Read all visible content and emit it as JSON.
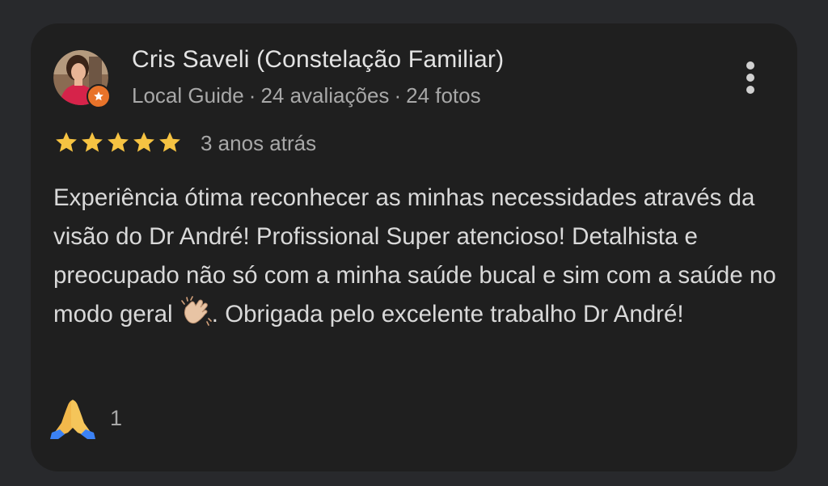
{
  "review": {
    "reviewer_name": "Cris Saveli (Constelação Familiar)",
    "reviewer_level": "Local Guide",
    "review_count": "24 avaliações",
    "photo_count": "24 fotos",
    "separator": "·",
    "rating": 5,
    "max_rating": 5,
    "time_ago": "3 anos atrás",
    "text_before_emoji": "Experiência ótima reconhecer as minhas necessidades através da visão do Dr André! Profissional Super atencioso! Detalhista e preocupado não só com a minha saúde bucal e sim com a saúde no modo geral ",
    "inline_emoji": "clapping-hands-icon",
    "text_after_emoji": ". Obrigada pelo excelente trabalho Dr André!",
    "reaction_icon": "folded-hands-icon",
    "reaction_count": "1"
  },
  "icons": {
    "more_menu": "more-vert-icon",
    "guide_badge": "star-badge-icon"
  },
  "colors": {
    "page_background": "#28292c",
    "card_background": "#1f1f1f",
    "star": "#f6c342",
    "badge": "#e8732a",
    "primary_text": "#e3e3e3",
    "secondary_text": "#a8a8a8"
  }
}
